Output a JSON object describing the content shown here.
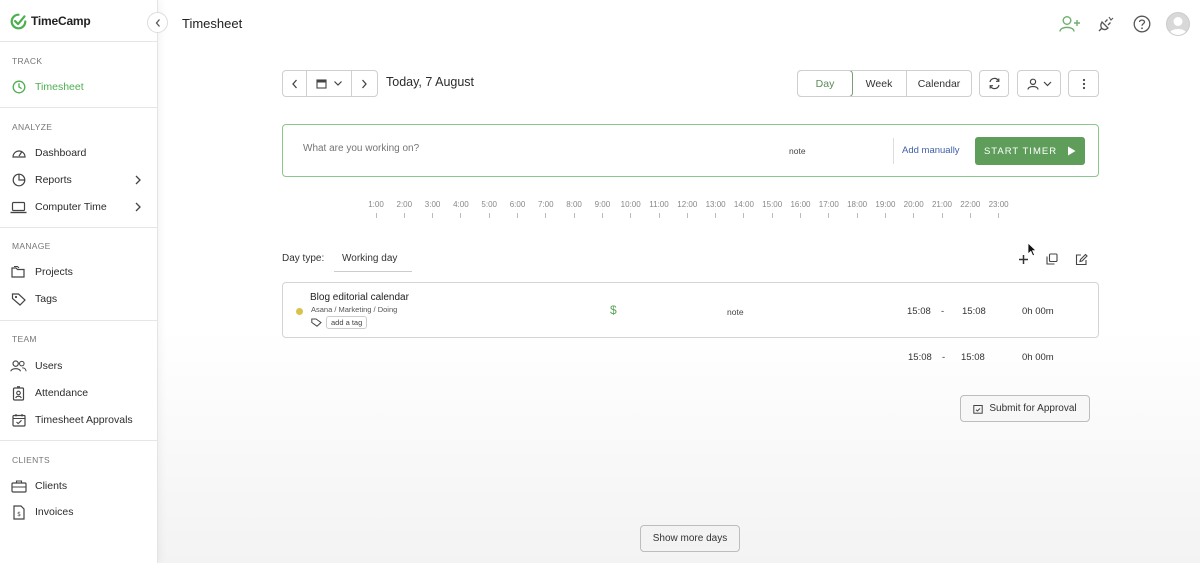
{
  "app": {
    "name": "TimeCamp",
    "brand_color": "#4caf50"
  },
  "sidebar": {
    "sections": [
      {
        "title": "TRACK",
        "items": [
          {
            "label": "Timesheet",
            "icon": "clock-icon",
            "active": true
          }
        ]
      },
      {
        "title": "ANALYZE",
        "items": [
          {
            "label": "Dashboard",
            "icon": "gauge-icon"
          },
          {
            "label": "Reports",
            "icon": "pie-chart-icon",
            "has_submenu": true
          },
          {
            "label": "Computer Time",
            "icon": "laptop-icon",
            "has_submenu": true
          }
        ]
      },
      {
        "title": "MANAGE",
        "items": [
          {
            "label": "Projects",
            "icon": "folders-icon"
          },
          {
            "label": "Tags",
            "icon": "tag-icon"
          }
        ]
      },
      {
        "title": "TEAM",
        "items": [
          {
            "label": "Users",
            "icon": "users-icon"
          },
          {
            "label": "Attendance",
            "icon": "badge-icon"
          },
          {
            "label": "Timesheet Approvals",
            "icon": "calendar-check-icon"
          }
        ]
      },
      {
        "title": "CLIENTS",
        "items": [
          {
            "label": "Clients",
            "icon": "briefcase-icon"
          },
          {
            "label": "Invoices",
            "icon": "invoice-icon"
          }
        ]
      }
    ]
  },
  "header": {
    "title": "Timesheet",
    "icons": [
      "add-user-icon",
      "plug-icon",
      "help-icon",
      "avatar"
    ]
  },
  "date_nav": {
    "label": "Today, 7 August"
  },
  "view_tabs": [
    {
      "label": "Day",
      "active": true
    },
    {
      "label": "Week"
    },
    {
      "label": "Calendar"
    }
  ],
  "timer": {
    "placeholder": "What are you working on?",
    "note": "note",
    "add_manually": "Add manually",
    "start": "START TIMER",
    "accent": "#5e9e5a"
  },
  "timeline": {
    "hours": [
      "1:00",
      "2:00",
      "3:00",
      "4:00",
      "5:00",
      "6:00",
      "7:00",
      "8:00",
      "9:00",
      "10:00",
      "11:00",
      "12:00",
      "13:00",
      "14:00",
      "15:00",
      "16:00",
      "17:00",
      "18:00",
      "19:00",
      "20:00",
      "21:00",
      "22:00",
      "23:00"
    ]
  },
  "day_type": {
    "label": "Day type:",
    "value": "Working day"
  },
  "entries": [
    {
      "task": "Blog editorial calendar",
      "path": "Asana / Marketing / Doing",
      "add_tag": "add a tag",
      "billable": "$",
      "note": "note",
      "start": "15:08",
      "sep": "-",
      "end": "15:08",
      "duration": "0h 00m",
      "dot_color": "#d8c24a"
    }
  ],
  "totals": {
    "start": "15:08",
    "sep": "-",
    "end": "15:08",
    "duration": "0h 00m"
  },
  "submit": {
    "label": "Submit for Approval"
  },
  "show_more": {
    "label": "Show more days"
  }
}
